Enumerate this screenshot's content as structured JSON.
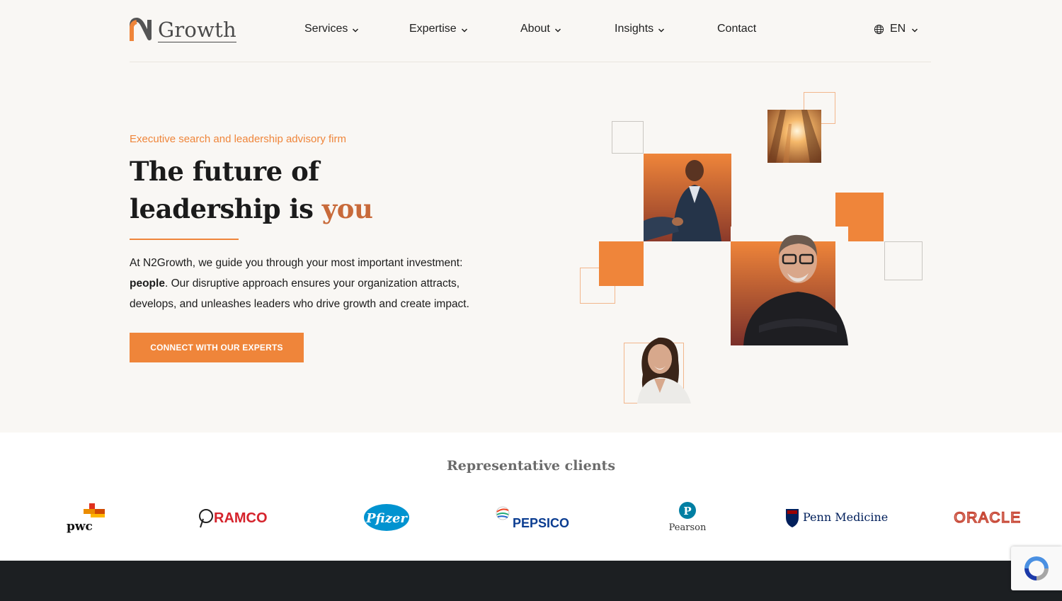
{
  "header": {
    "logo_text": "Growth",
    "nav": [
      {
        "label": "Services",
        "has_dropdown": true
      },
      {
        "label": "Expertise",
        "has_dropdown": true
      },
      {
        "label": "About",
        "has_dropdown": true
      },
      {
        "label": "Insights",
        "has_dropdown": true
      },
      {
        "label": "Contact",
        "has_dropdown": false
      }
    ],
    "language": "EN"
  },
  "hero": {
    "eyebrow": "Executive search and leadership advisory firm",
    "title_line1": "The future of",
    "title_line2_prefix": "leadership is ",
    "title_line2_accent": "you",
    "body_prefix": "At N2Growth, we guide you through your most important investment: ",
    "body_bold": "people",
    "body_suffix": ". Our disruptive approach ensures your organization attracts, develops, and unleashes leaders who drive growth and create impact.",
    "cta_label": "CONNECT WITH OUR EXPERTS"
  },
  "clients": {
    "title": "Representative clients",
    "logos": [
      {
        "name": "pwc",
        "text": "pwc"
      },
      {
        "name": "ramco",
        "text": "RAMCO"
      },
      {
        "name": "pfizer",
        "text": "Pfizer"
      },
      {
        "name": "pepsico",
        "text": "PEPSICO"
      },
      {
        "name": "pearson",
        "text": "Pearson",
        "mark": "P"
      },
      {
        "name": "penn-medicine",
        "text": "Penn Medicine"
      },
      {
        "name": "oracle",
        "text": "ORACLE"
      }
    ]
  },
  "colors": {
    "accent": "#ef853a",
    "accent_text": "#c86a3a",
    "background": "#f9f7f4",
    "dark": "#1c1f22"
  },
  "icons": {
    "dropdown": "chevron-down-icon",
    "language": "globe-icon",
    "recaptcha": "recaptcha-icon"
  }
}
